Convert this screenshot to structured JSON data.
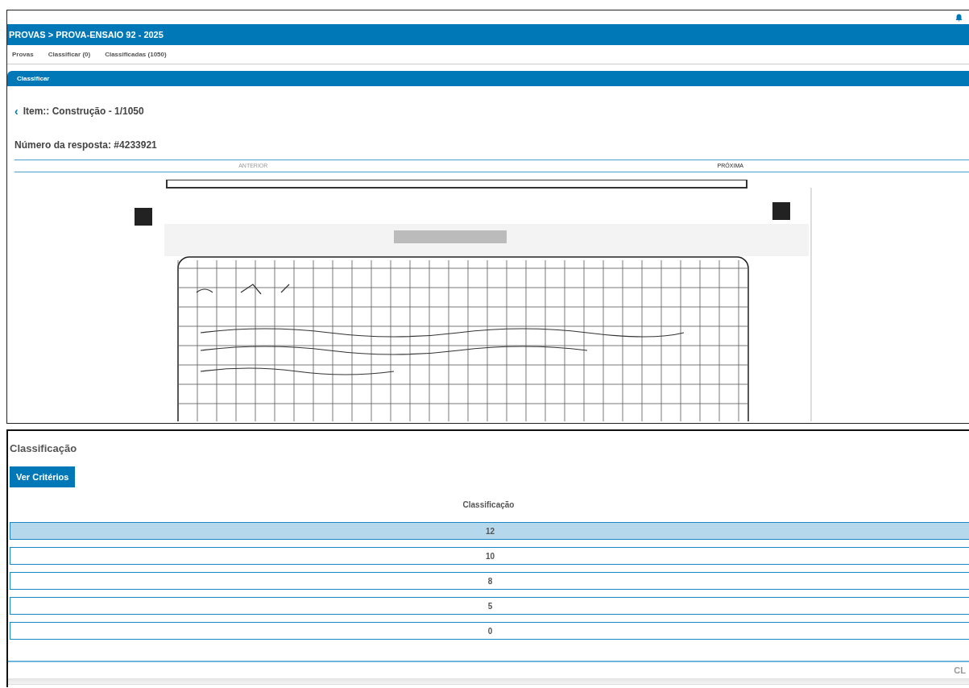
{
  "header": {
    "title": "PROVAS > PROVA-ENSAIO 92 - 2025"
  },
  "nav": [
    {
      "label": "Provas",
      "selected": false
    },
    {
      "label": "Classificar (0)",
      "selected": false
    },
    {
      "label": "Classificadas (1050)",
      "selected": false
    }
  ],
  "panel": {
    "title": "Classificar"
  },
  "item": {
    "back": "‹",
    "title": "Item:: Construção - 1/1050"
  },
  "response_number": "Número da resposta: #4233921",
  "pager": [
    {
      "label": "ANTERIOR",
      "disabled": true
    },
    {
      "label": "PRÓXIMA",
      "disabled": false
    }
  ],
  "classification": {
    "heading": "Classificação",
    "criteria_button": "Ver Critérios",
    "table_title": "Classificação",
    "options": [
      {
        "label": "12",
        "selected": true
      },
      {
        "label": "10",
        "selected": false
      },
      {
        "label": "8",
        "selected": false
      },
      {
        "label": "5",
        "selected": false
      },
      {
        "label": "0",
        "selected": false
      }
    ],
    "submit": {
      "label": "CL",
      "disabled": true
    }
  }
}
